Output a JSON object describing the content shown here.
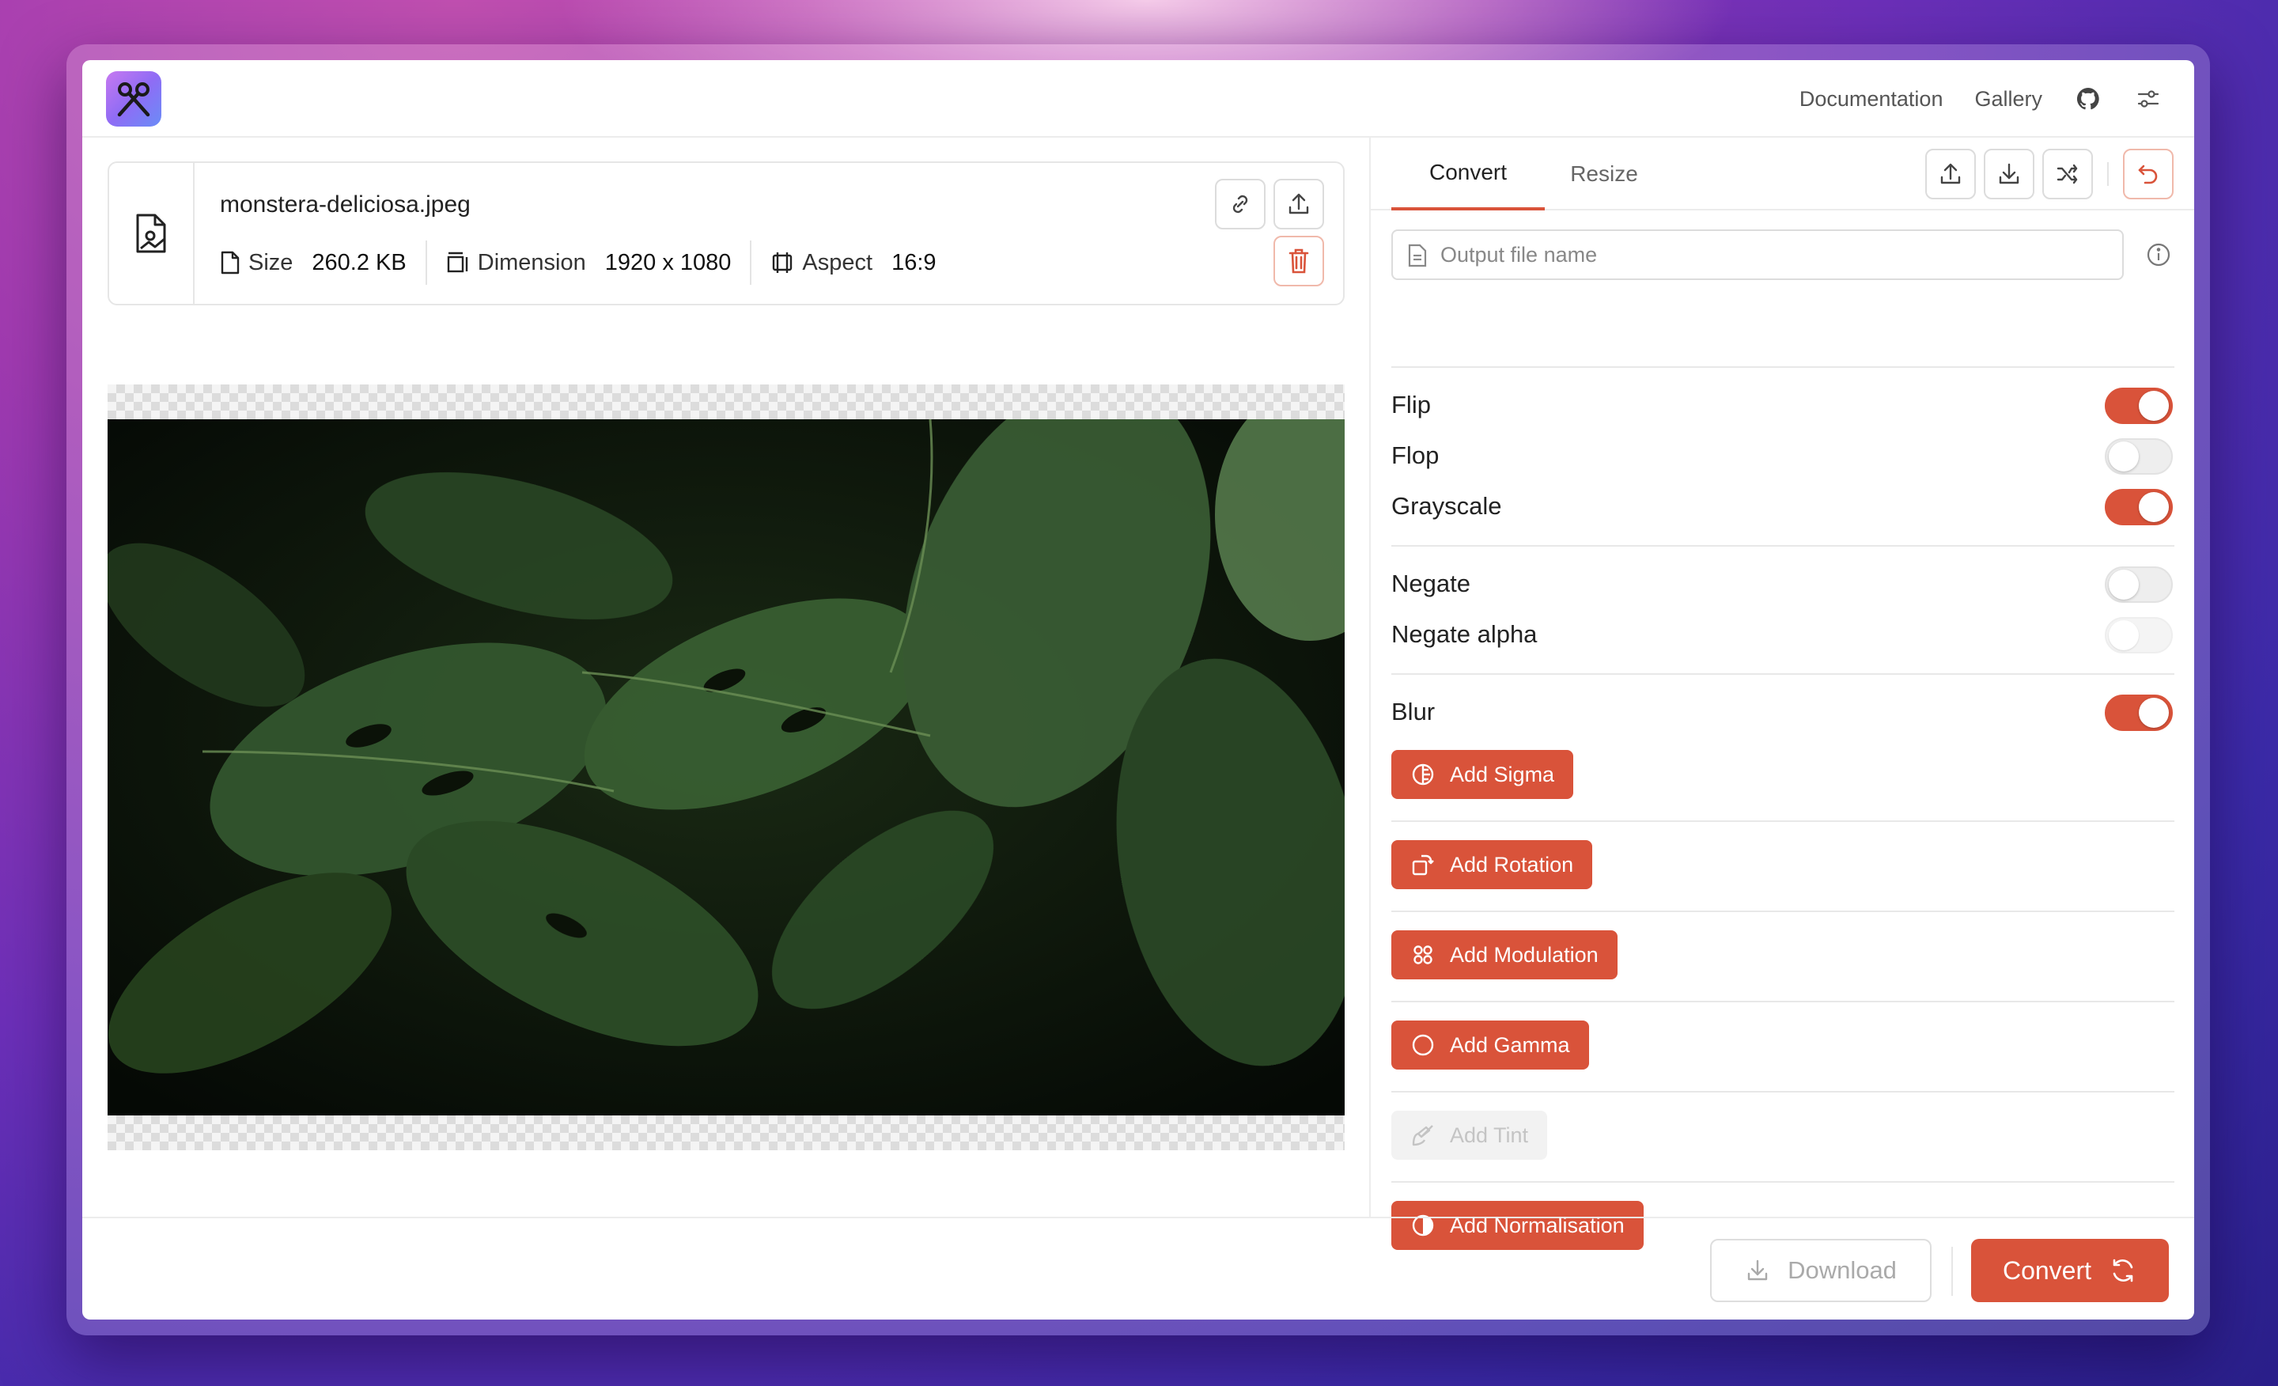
{
  "header": {
    "nav": {
      "documentation": "Documentation",
      "gallery": "Gallery"
    },
    "icons": [
      "scissors-logo-icon",
      "github-icon",
      "settings-sliders-icon"
    ]
  },
  "file": {
    "name": "monstera-deliciosa.jpeg",
    "size_label": "Size",
    "size_value": "260.2 KB",
    "dimension_label": "Dimension",
    "dimension_value": "1920 x 1080",
    "aspect_label": "Aspect",
    "aspect_value": "16:9"
  },
  "tabs": [
    {
      "label": "Convert",
      "active": true
    },
    {
      "label": "Resize",
      "active": false
    }
  ],
  "output": {
    "placeholder": "Output file name",
    "value": ""
  },
  "options": [
    {
      "label": "Flip",
      "on": true,
      "disabled": false
    },
    {
      "label": "Flop",
      "on": false,
      "disabled": false
    },
    {
      "label": "Grayscale",
      "on": true,
      "disabled": false
    },
    {
      "label": "Negate",
      "on": false,
      "disabled": false
    },
    {
      "label": "Negate alpha",
      "on": false,
      "disabled": true
    },
    {
      "label": "Blur",
      "on": true,
      "disabled": false
    }
  ],
  "add_buttons": [
    {
      "label": "Add Sigma",
      "icon": "half-circle-icon",
      "disabled": false
    },
    {
      "label": "Add Rotation",
      "icon": "rotate-icon",
      "disabled": false
    },
    {
      "label": "Add Modulation",
      "icon": "grid-circles-icon",
      "disabled": false
    },
    {
      "label": "Add Gamma",
      "icon": "circle-icon",
      "disabled": false
    },
    {
      "label": "Add Tint",
      "icon": "brush-icon",
      "disabled": true
    },
    {
      "label": "Add Normalisation",
      "icon": "contrast-icon",
      "disabled": false
    }
  ],
  "footer": {
    "download_label": "Download",
    "convert_label": "Convert"
  },
  "colors": {
    "accent": "#d9533a",
    "text": "#222222",
    "border": "#e6e6e6"
  }
}
